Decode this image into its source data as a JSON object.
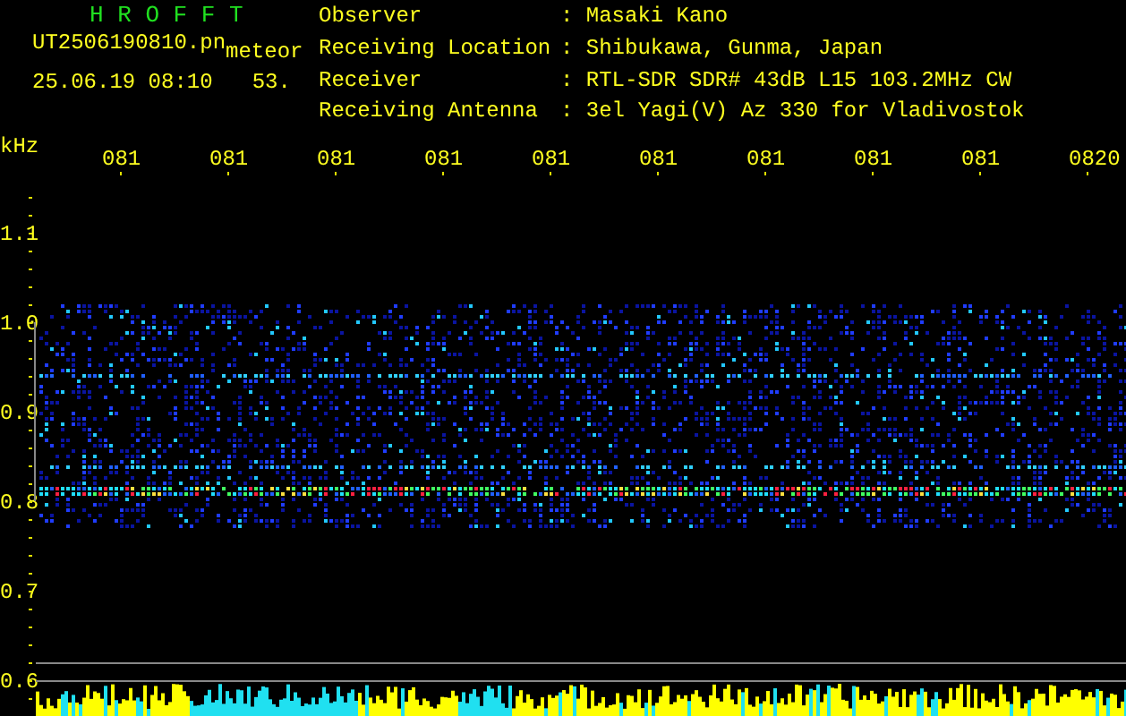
{
  "title": "H R O F F T",
  "file": {
    "name": "UT2506190810.pn",
    "type": "meteor",
    "datetime": "25.06.19 08:10",
    "value": "53."
  },
  "info": [
    {
      "key": "Observer",
      "separator": ":",
      "value": "Masaki Kano"
    },
    {
      "key": "Receiving Location",
      "separator": ":",
      "value": "Shibukawa, Gunma, Japan"
    },
    {
      "key": "Receiver",
      "separator": ":",
      "value": "RTL-SDR SDR# 43dB L15 103.2MHz CW"
    },
    {
      "key": "Receiving Antenna",
      "separator": ":",
      "value": "3el Yagi(V) Az 330 for Vladivostok"
    }
  ],
  "unit": "kHz",
  "time_labels": [
    "081",
    "081",
    "081",
    "081",
    "081",
    "081",
    "081",
    "081",
    "081",
    "0820"
  ],
  "freq_labels": [
    "1.1",
    "1.0",
    "0.9",
    "0.8",
    "0.7",
    "0.6"
  ]
}
